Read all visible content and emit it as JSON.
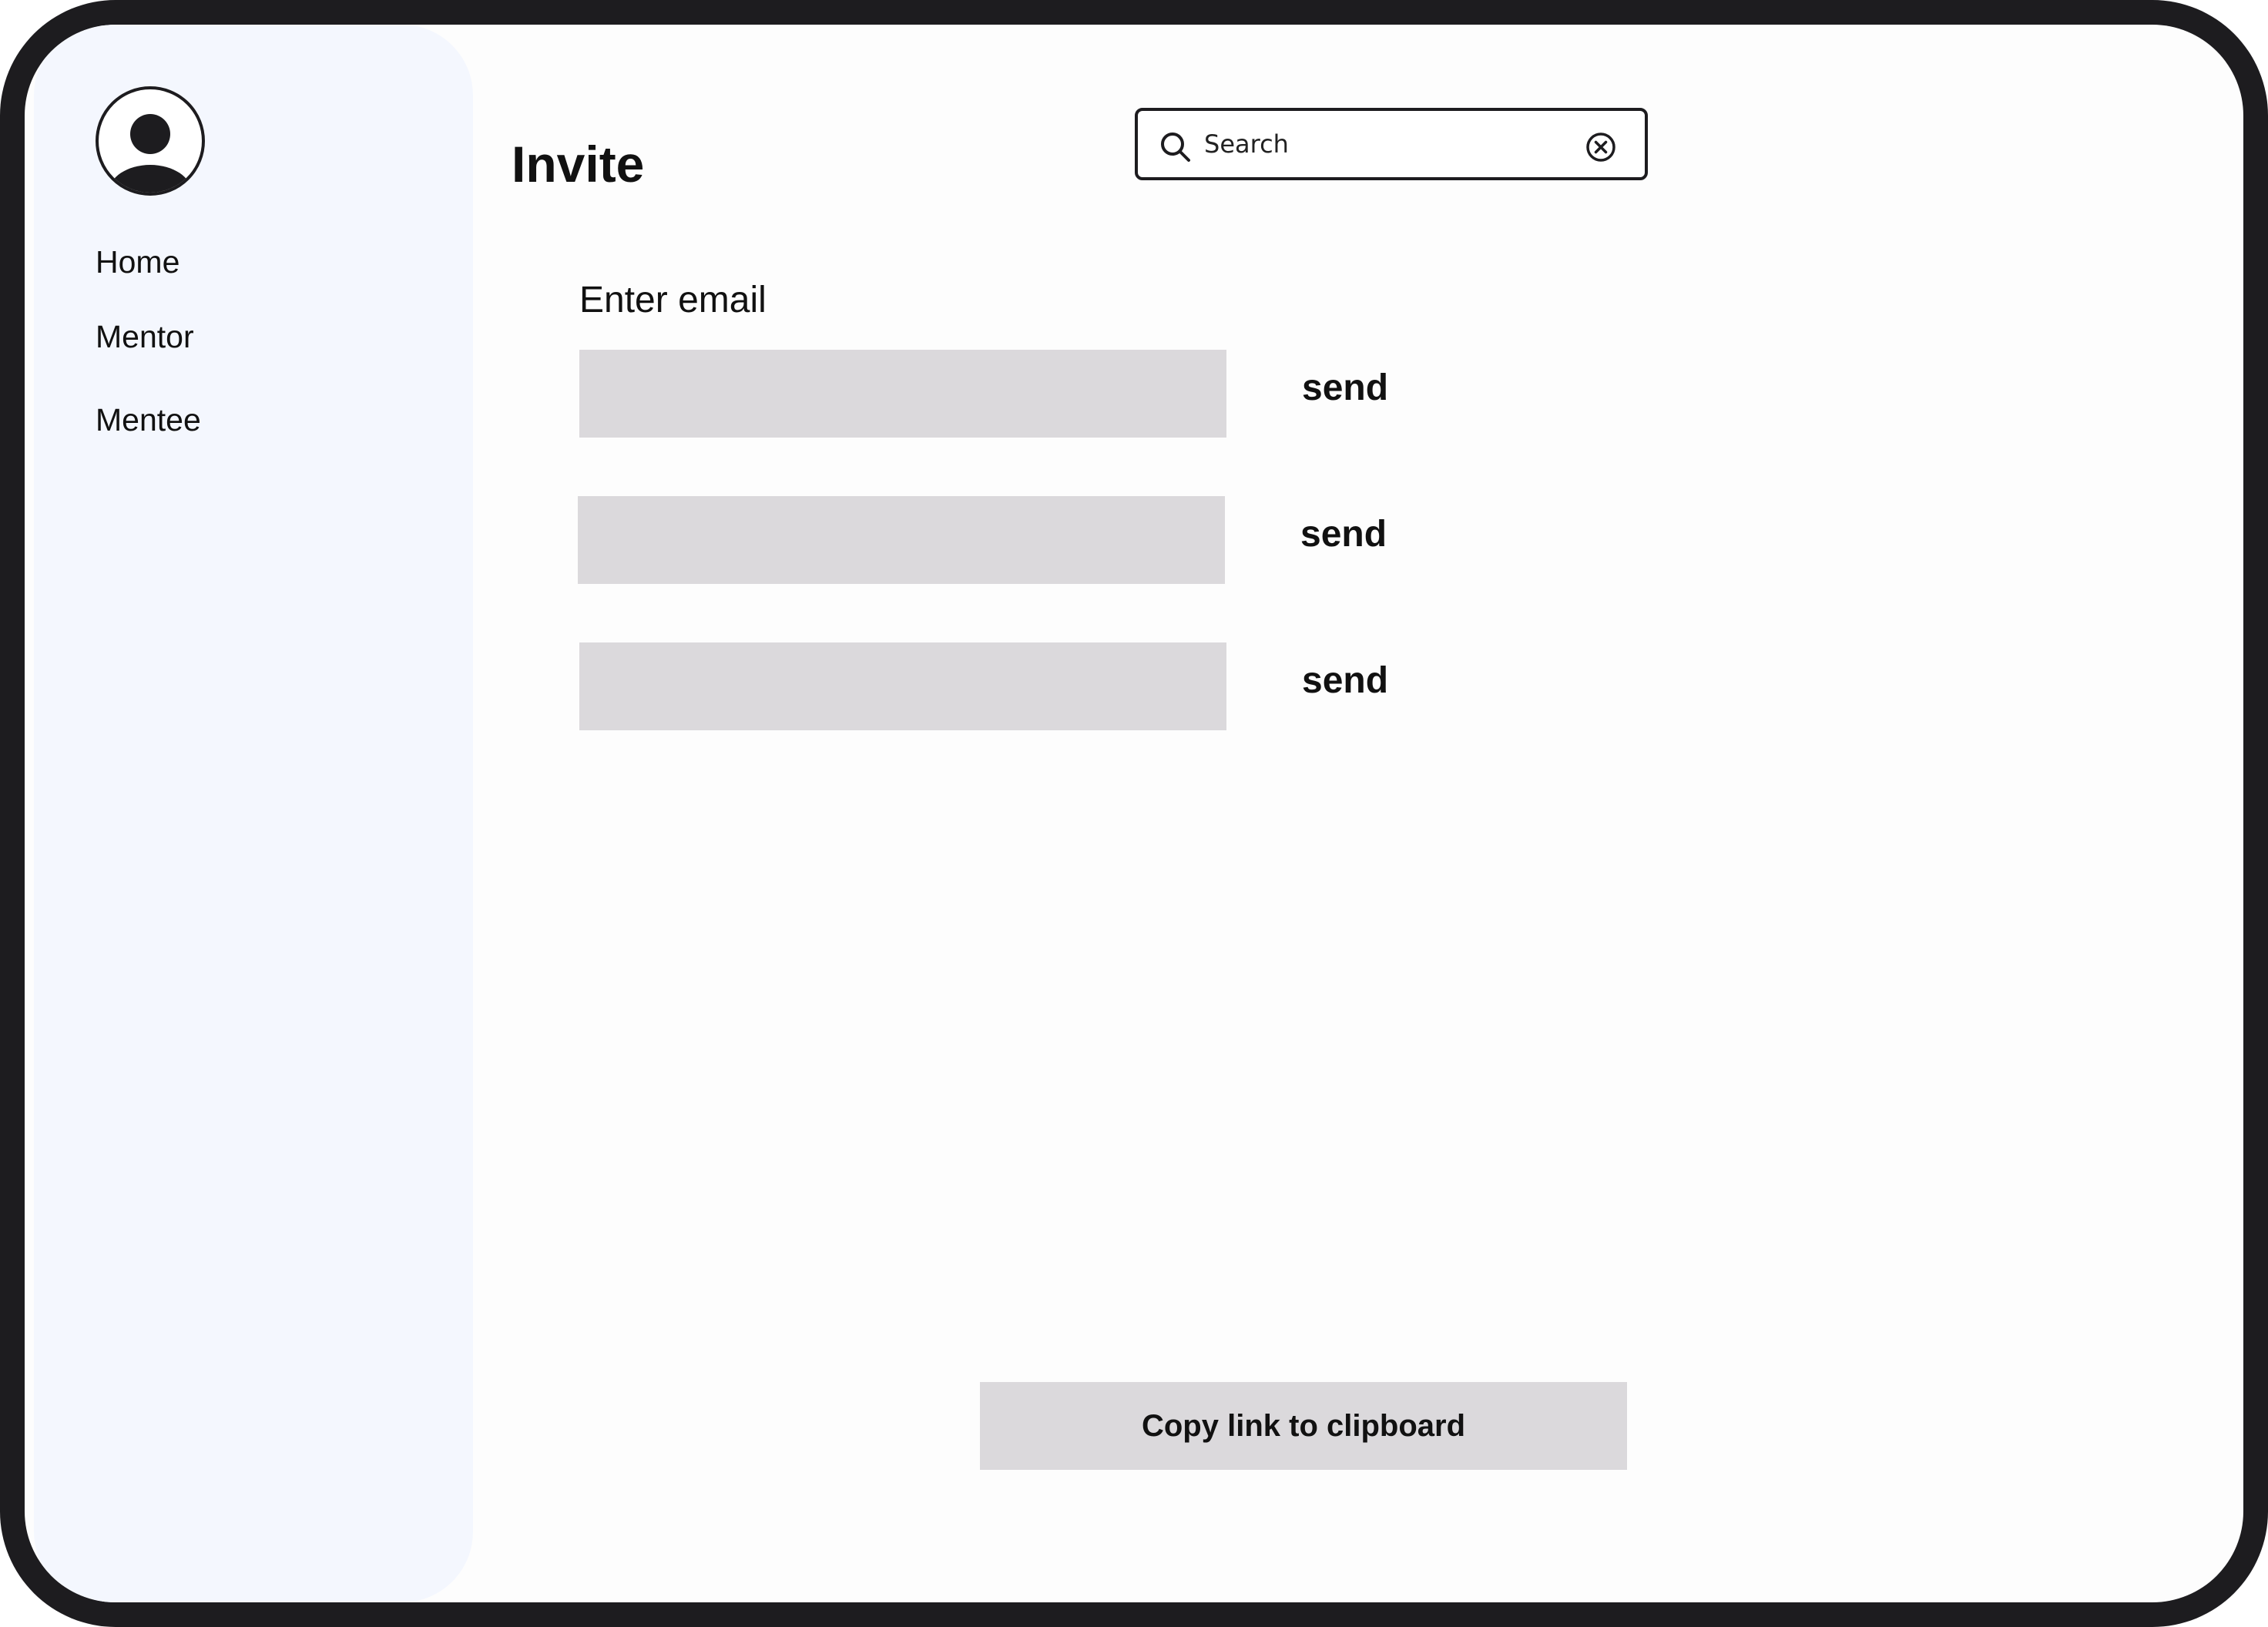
{
  "sidebar": {
    "avatar_icon": "user-avatar-icon",
    "items": [
      {
        "label": "Home"
      },
      {
        "label": "Mentor"
      },
      {
        "label": "Mentee"
      }
    ]
  },
  "header": {
    "title": "Invite"
  },
  "search": {
    "placeholder": "Search",
    "value": "",
    "search_icon": "search-icon",
    "clear_icon": "clear-circle-x-icon"
  },
  "main": {
    "email_label": "Enter email",
    "email_rows": [
      {
        "value": "",
        "send_label": "send"
      },
      {
        "value": "",
        "send_label": "send"
      },
      {
        "value": "",
        "send_label": "send"
      }
    ],
    "copy_link_label": "Copy link to clipboard"
  },
  "colors": {
    "frame": "#1d1c1f",
    "sidebar_bg": "#f4f7fe",
    "input_bg": "#dbd9dc"
  }
}
